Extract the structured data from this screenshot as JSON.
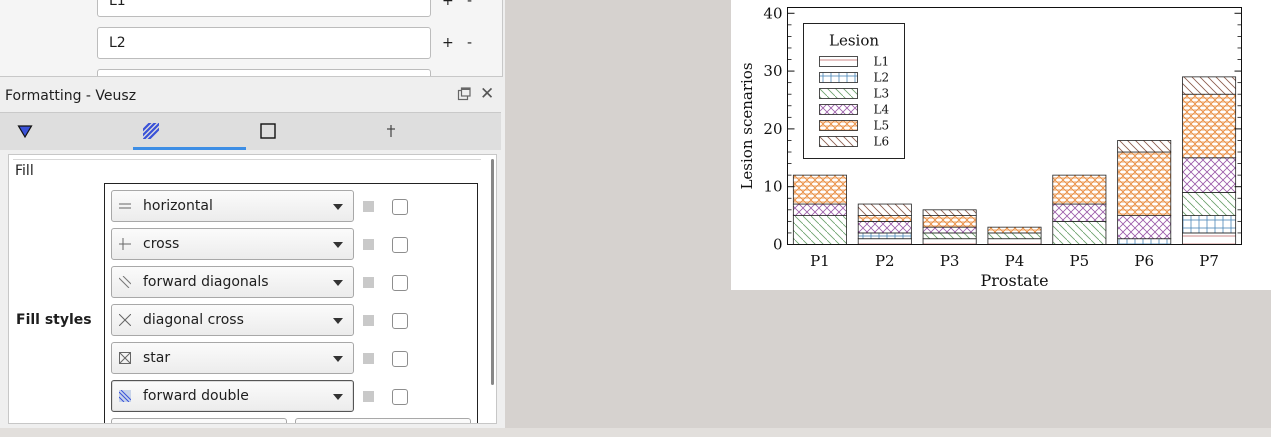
{
  "label_panel": {
    "rows": [
      {
        "value": "L1",
        "plus": "+",
        "minus": "-"
      },
      {
        "value": "L2",
        "plus": "+",
        "minus": "-"
      }
    ]
  },
  "formatting": {
    "title": "Formatting - Veusz",
    "float_icon": "float-window-icon",
    "close": "✕",
    "tabs": [
      {
        "icon": "triangle-marker-icon"
      },
      {
        "icon": "hatch-fill-icon",
        "active": true
      },
      {
        "icon": "square-border-icon"
      },
      {
        "icon": "error-bar-icon"
      }
    ],
    "section": "Fill",
    "fill_styles_label": "Fill styles",
    "fill_styles": [
      {
        "label": "horizontal",
        "icon": "horizontal-pattern-icon"
      },
      {
        "label": "cross",
        "icon": "cross-pattern-icon"
      },
      {
        "label": "forward diagonals",
        "icon": "forward-diagonals-pattern-icon"
      },
      {
        "label": "diagonal cross",
        "icon": "diagonal-cross-pattern-icon"
      },
      {
        "label": "star",
        "icon": "star-pattern-icon"
      },
      {
        "label": "forward double",
        "icon": "forward-double-pattern-icon"
      }
    ]
  },
  "chart_data": {
    "type": "bar",
    "stacked": true,
    "categories": [
      "P1",
      "P2",
      "P3",
      "P4",
      "P5",
      "P6",
      "P7"
    ],
    "xlabel": "Prostate",
    "ylabel": "Lesion scenarios",
    "ylim": [
      0,
      41
    ],
    "yticks": [
      0,
      10,
      20,
      30,
      40
    ],
    "legend": {
      "title": "Lesion",
      "position": "top-left"
    },
    "series": [
      {
        "name": "L1",
        "values": [
          0,
          1,
          1,
          1,
          0,
          0,
          2
        ],
        "color": "#c46a6a"
      },
      {
        "name": "L2",
        "values": [
          0,
          1,
          0,
          0,
          0,
          1,
          3
        ],
        "color": "#4a86b8"
      },
      {
        "name": "L3",
        "values": [
          5,
          0,
          1,
          1,
          4,
          0,
          4
        ],
        "color": "#6aa06a"
      },
      {
        "name": "L4",
        "values": [
          2,
          2,
          1,
          0,
          3,
          4,
          6
        ],
        "color": "#9a5aa8"
      },
      {
        "name": "L5",
        "values": [
          5,
          1,
          2,
          1,
          5,
          11,
          11
        ],
        "color": "#e8893a"
      },
      {
        "name": "L6",
        "values": [
          0,
          2,
          1,
          0,
          0,
          2,
          3
        ],
        "color": "#8a5a4a"
      }
    ]
  }
}
